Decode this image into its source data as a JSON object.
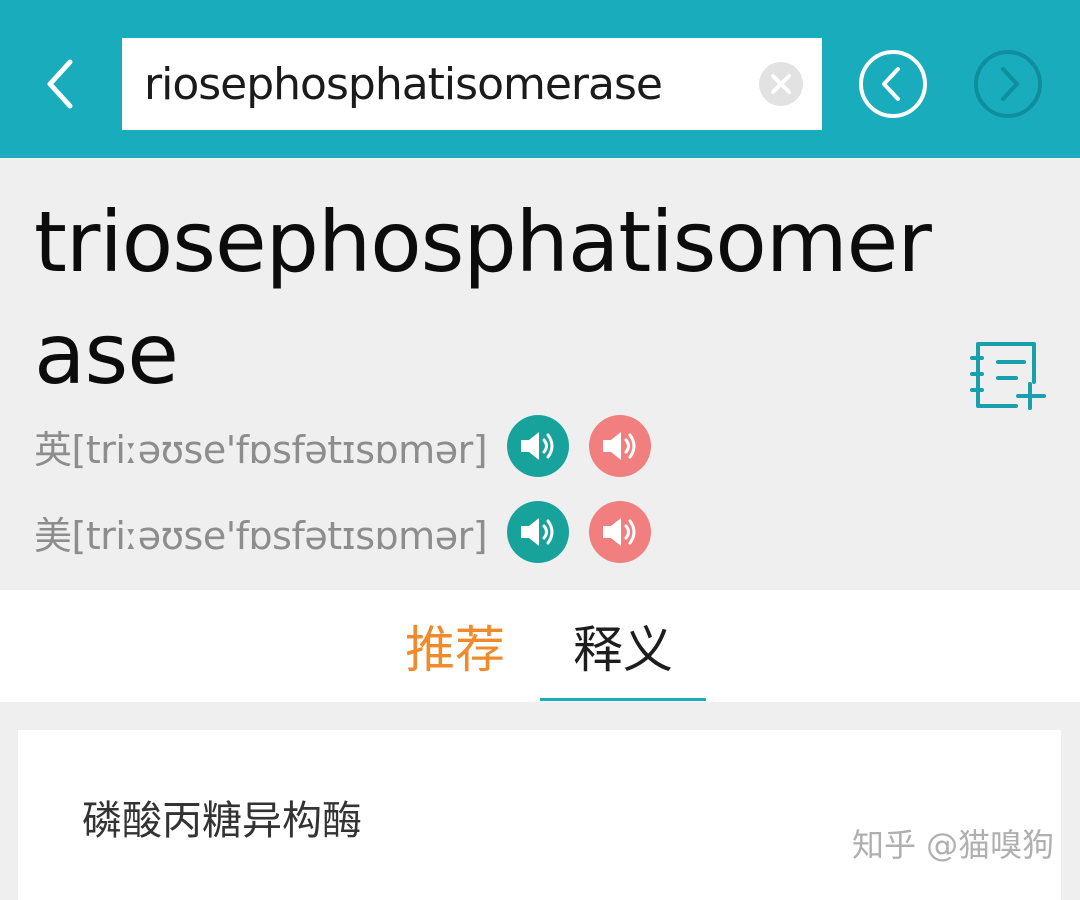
{
  "colors": {
    "accent": "#18acbd",
    "teal": "#17a39c",
    "coral": "#f27f7f",
    "orange": "#f08b2d"
  },
  "header": {
    "back_icon": "chevron-left-icon",
    "search": {
      "value": "riosephosphatisomerase"
    },
    "clear_icon": "clear-icon",
    "prev_icon": "circle-chevron-left-icon",
    "next_icon": "circle-chevron-right-icon"
  },
  "word": {
    "headword": "triosephosphatisomerase",
    "add_icon": "add-to-wordbook-icon",
    "phonetics": [
      {
        "label": "英[triːəʊse'fɒsfətɪsɒmər]",
        "icons": [
          "speaker-icon",
          "speaker-icon"
        ]
      },
      {
        "label": "美[triːəʊse'fɒsfətɪsɒmər]",
        "icons": [
          "speaker-icon",
          "speaker-icon"
        ]
      }
    ]
  },
  "tabs": [
    {
      "label": "推荐",
      "active": false
    },
    {
      "label": "释义",
      "active": true
    }
  ],
  "content": {
    "definition": "磷酸丙糖异构酶"
  },
  "watermark": "知乎 @猫嗅狗"
}
